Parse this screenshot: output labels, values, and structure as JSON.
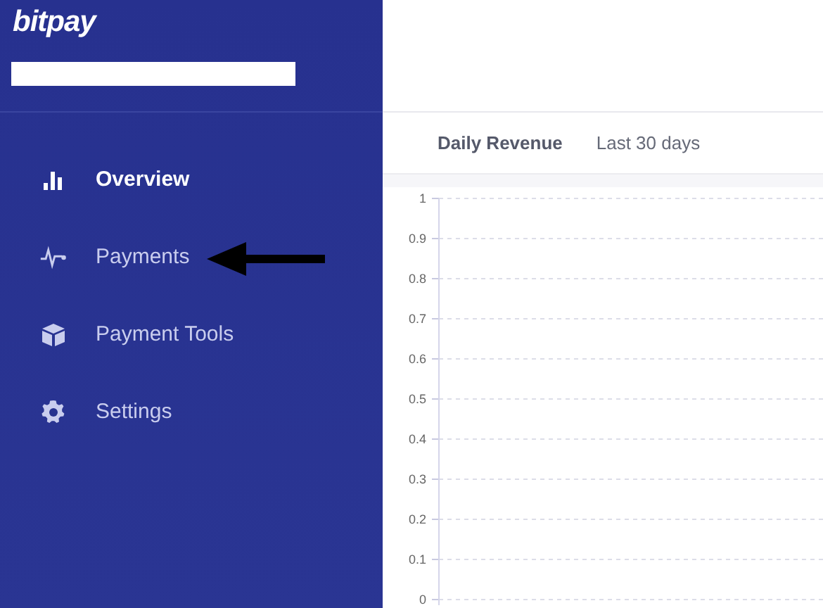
{
  "logo": "bitpay",
  "sidebar": {
    "items": [
      {
        "label": "Overview",
        "kind": "bars",
        "selected": true
      },
      {
        "label": "Payments",
        "kind": "pulse",
        "selected": false
      },
      {
        "label": "Payment Tools",
        "kind": "cube",
        "selected": false
      },
      {
        "label": "Settings",
        "kind": "gear",
        "selected": false
      }
    ]
  },
  "tabs": [
    {
      "label": "Daily Revenue",
      "selected": true
    },
    {
      "label": "Last 30 days",
      "selected": false
    }
  ],
  "chart_data": {
    "type": "line",
    "grid": true,
    "categories": [
      null,
      null,
      null,
      null,
      null,
      null,
      null,
      null,
      null,
      null,
      null,
      null,
      null,
      null,
      null,
      null,
      null,
      null,
      null,
      null,
      null,
      null,
      null,
      null,
      null,
      null,
      null,
      null,
      null,
      null
    ],
    "values": [
      null,
      null,
      null,
      null,
      null,
      null,
      null,
      null,
      null,
      null,
      null,
      null,
      null,
      null,
      null,
      null,
      null,
      null,
      null,
      null,
      null,
      null,
      null,
      null,
      null,
      null,
      null,
      null,
      null,
      null
    ],
    "ylim": [
      0,
      1
    ],
    "yticks": [
      0,
      0.1,
      0.2,
      0.3,
      0.4,
      0.5,
      0.6,
      0.7,
      0.8,
      0.9,
      1
    ]
  }
}
